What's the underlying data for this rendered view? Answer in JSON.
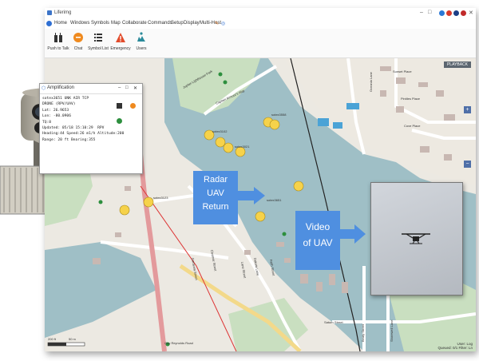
{
  "app": {
    "title": "Liferimg",
    "window_controls": [
      "–",
      "□",
      "✕"
    ]
  },
  "menu": {
    "items": [
      "Home",
      "Windows",
      "Symbols",
      "Map",
      "Collaborate",
      "Commands",
      "Setup",
      "Display",
      "Multi-Host"
    ]
  },
  "toolbar": {
    "buttons": [
      {
        "label": "Push to Talk",
        "icon": "radio-icon"
      },
      {
        "label": "Chat",
        "icon": "chat-icon"
      },
      {
        "label": "Symbol List",
        "icon": "list-icon"
      },
      {
        "label": "Emergency",
        "icon": "warning-icon"
      },
      {
        "label": "Users",
        "icon": "users-icon"
      }
    ]
  },
  "popup": {
    "title": "Amplification",
    "lines": [
      "sotex3651 UNK AIR TCP",
      "DRONE (RPV/UAV)",
      "Lat: 26.9653",
      "Lon: -80.0906",
      "TQ:8",
      "Updated: 05/18 15:10:29  RPV",
      "Heading:44 Speed:26 m1/h Altitude:200",
      "Range: 20 ft Bearing:355"
    ]
  },
  "map": {
    "playback_label": "PLAYBACK",
    "street_labels": [
      "Jupiter Lighthouse Park",
      "Captain Armour's Way",
      "Sunset Place",
      "Pintiles Place",
      "Cove Place",
      "Oceania Lane",
      "Gardenia Street",
      "Cleomar Street",
      "Lane Street",
      "Dakota Lane",
      "Faith Street",
      "Saturn Street",
      "Guy Reynolds Road",
      "Beaty Street",
      "Shorewell Lane"
    ],
    "track_labels": [
      "sotex3651",
      "sotex3558",
      "sotex3102",
      "sotex3123",
      "sotex3021"
    ],
    "scale_labels": [
      "200 ft",
      "50 m"
    ],
    "user_status": [
      "User: Log",
      "Queued: 0/1  Filter: Ln"
    ]
  },
  "callouts": {
    "radar": [
      "Radar",
      "UAV",
      "Return"
    ],
    "video": [
      "Video",
      "of UAV"
    ]
  },
  "colors": {
    "accent": "#4f8fe0",
    "water": "#9fbfc6",
    "park": "#c9dfc0",
    "road_main": "#e39a9c",
    "marker": "#f6d24a"
  }
}
